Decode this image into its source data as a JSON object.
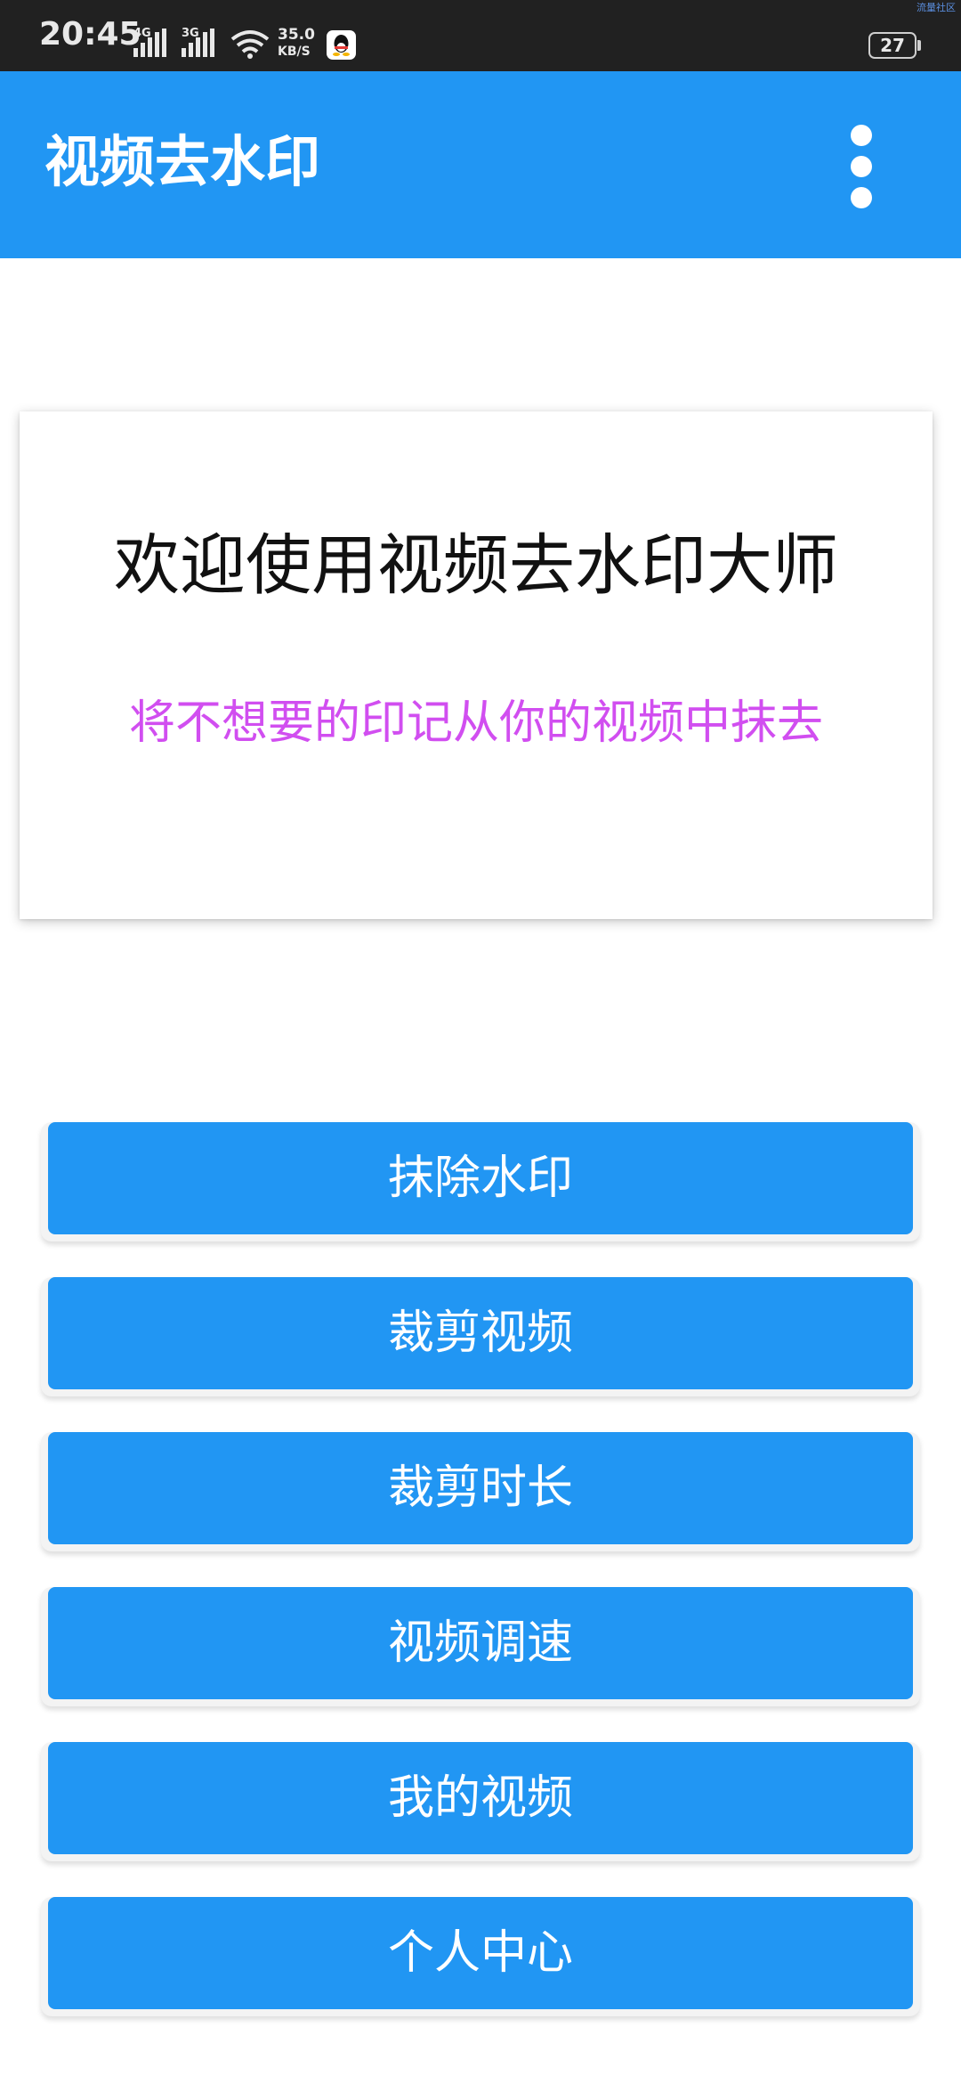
{
  "status_bar": {
    "time": "20:45",
    "signal_1_label": "4G",
    "signal_2_label": "3G",
    "speed_value": "35.0",
    "speed_unit": "KB/S",
    "battery": "27",
    "corner_tag": "流量社区",
    "icons": [
      "signal-4g-icon",
      "signal-3g-icon",
      "wifi-icon",
      "qq-icon",
      "battery-icon"
    ]
  },
  "app_bar": {
    "title": "视频去水印",
    "menu_icon": "overflow-menu-icon"
  },
  "welcome_card": {
    "title": "欢迎使用视频去水印大师",
    "subtitle": "将不想要的印记从你的视频中抹去",
    "subtitle_color": "#d14ef0"
  },
  "actions": [
    {
      "label": "抹除水印"
    },
    {
      "label": "裁剪视频"
    },
    {
      "label": "裁剪时长"
    },
    {
      "label": "视频调速"
    },
    {
      "label": "我的视频"
    },
    {
      "label": "个人中心"
    }
  ],
  "colors": {
    "primary": "#2196f3",
    "status_bar": "#212121"
  }
}
